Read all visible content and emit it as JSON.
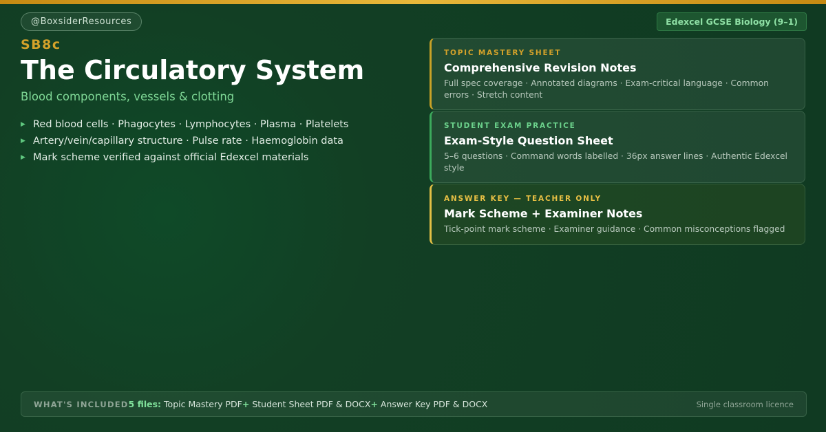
{
  "accent_colors": {
    "gold": "#c9a227",
    "green": "#3caa5c",
    "yellow": "#e3c045",
    "text_green": "#7fd896"
  },
  "header": {
    "handle": "@BoxsiderResources",
    "badge": "Edexcel GCSE Biology (9–1)"
  },
  "hero": {
    "code": "SB8c",
    "title": "The Circulatory System",
    "subtitle": "Blood components, vessels & clotting",
    "bullets": [
      "Red blood cells · Phagocytes · Lymphocytes · Plasma · Platelets",
      "Artery/vein/capillary structure · Pulse rate · Haemoglobin data",
      "Mark scheme verified against official Edexcel materials"
    ],
    "bullet_icon": "triangle-right-icon"
  },
  "cards": [
    {
      "label": "TOPIC MASTERY SHEET",
      "title": "Comprehensive Revision Notes",
      "desc": "Full spec coverage · Annotated diagrams · Exam-critical language · Common errors · Stretch content"
    },
    {
      "label": "STUDENT EXAM PRACTICE",
      "title": "Exam-Style Question Sheet",
      "desc": "5–6 questions · Command words labelled · 36px answer lines · Authentic Edexcel style"
    },
    {
      "label": "ANSWER KEY — TEACHER ONLY",
      "title": "Mark Scheme + Examiner Notes",
      "desc": "Tick-point mark scheme · Examiner guidance · Common misconceptions flagged"
    }
  ],
  "footer": {
    "label": "WHAT'S INCLUDED",
    "count": "5 files:",
    "item1": "Topic Mastery PDF",
    "plus": "+",
    "item2": "Student Sheet PDF & DOCX",
    "item3": "Answer Key PDF & DOCX",
    "licence": "Single classroom licence"
  }
}
